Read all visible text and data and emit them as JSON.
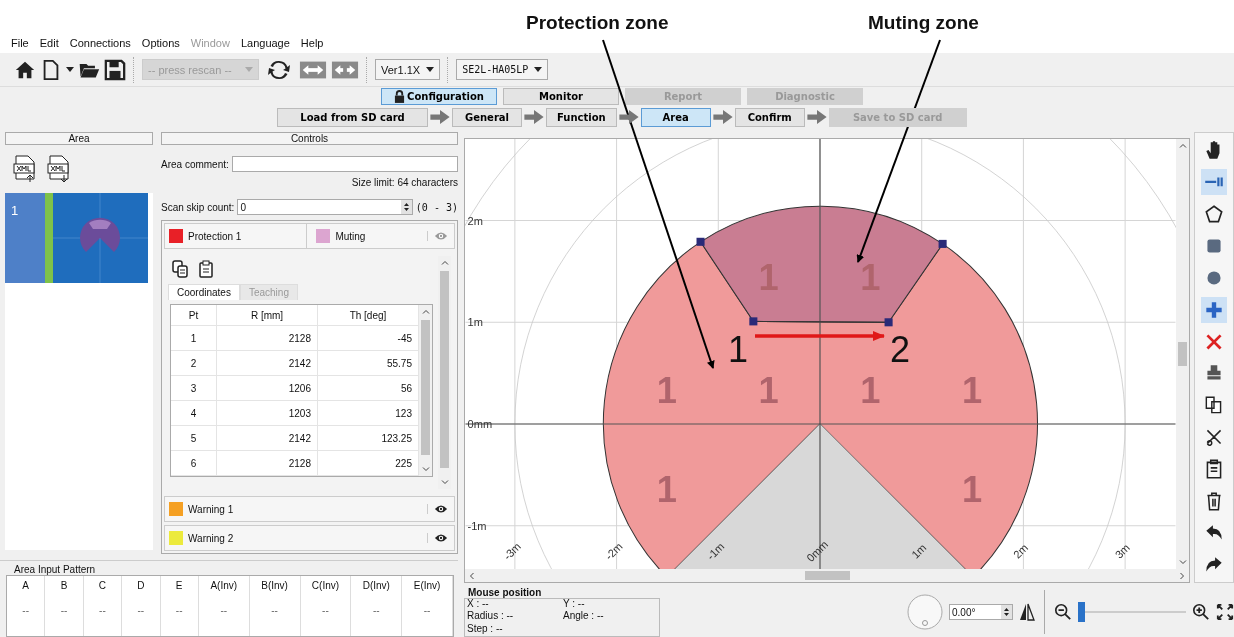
{
  "annotations": {
    "labels": [
      "Protection zone",
      "Muting zone"
    ],
    "point_labels": [
      "1",
      "2"
    ]
  },
  "menu": [
    {
      "label": "File",
      "disabled": false
    },
    {
      "label": "Edit",
      "disabled": false
    },
    {
      "label": "Connections",
      "disabled": false
    },
    {
      "label": "Options",
      "disabled": false
    },
    {
      "label": "Window",
      "disabled": true
    },
    {
      "label": "Language",
      "disabled": false
    },
    {
      "label": "Help",
      "disabled": false
    }
  ],
  "toolbar": {
    "port_placeholder": "-- press rescan --",
    "version": "Ver1.1X",
    "model": "SE2L-HA05LP"
  },
  "mode_tabs": [
    {
      "label": "Configuration",
      "selected": true,
      "disabled": false
    },
    {
      "label": "Monitor",
      "selected": false,
      "disabled": false
    },
    {
      "label": "Report",
      "selected": false,
      "disabled": true
    },
    {
      "label": "Diagnostic",
      "selected": false,
      "disabled": true
    }
  ],
  "steps": [
    {
      "label": "Load from SD card",
      "selected": false,
      "disabled": false
    },
    {
      "label": "General",
      "selected": false,
      "disabled": false
    },
    {
      "label": "Function",
      "selected": false,
      "disabled": false
    },
    {
      "label": "Area",
      "selected": true,
      "disabled": false
    },
    {
      "label": "Confirm",
      "selected": false,
      "disabled": false
    },
    {
      "label": "Save to SD card",
      "selected": false,
      "disabled": true
    }
  ],
  "area_panel": {
    "title": "Area",
    "items": [
      {
        "label": "1",
        "selected": true
      }
    ]
  },
  "controls": {
    "title": "Controls",
    "comment_label": "Area comment:",
    "size_limit": "Size limit: 64 characters",
    "skip_label": "Scan skip count:",
    "skip_value": "0",
    "skip_range": "(0 - 3)",
    "zones": [
      {
        "name": "Protection 1",
        "color": "#e82027",
        "expanded": true,
        "muting": {
          "name": "Muting",
          "color": "#dca5d0"
        }
      },
      {
        "name": "Warning 1",
        "color": "#f5a023",
        "expanded": false
      },
      {
        "name": "Warning 2",
        "color": "#ecea3c",
        "expanded": false
      }
    ],
    "tabs": [
      {
        "label": "Coordinates",
        "selected": true
      },
      {
        "label": "Teaching",
        "selected": false
      }
    ],
    "table": {
      "columns": [
        "Pt",
        "R [mm]",
        "Th [deg]"
      ],
      "rows": [
        [
          "1",
          "2128",
          "-45"
        ],
        [
          "2",
          "2142",
          "55.75"
        ],
        [
          "3",
          "1206",
          "56"
        ],
        [
          "4",
          "1203",
          "123"
        ],
        [
          "5",
          "2142",
          "123.25"
        ],
        [
          "6",
          "2128",
          "225"
        ]
      ]
    }
  },
  "canvas": {
    "y_labels": [
      "2m",
      "1m",
      "0mm",
      "-1m"
    ],
    "x_labels": [
      "-3m",
      "-2m",
      "-1m",
      "0mm",
      "1m",
      "2m",
      "3m"
    ],
    "zone_marks": [
      "1",
      "1",
      "1",
      "1",
      "1",
      "1",
      "1",
      "1"
    ]
  },
  "input_pattern": {
    "title": "Area Input Pattern",
    "columns": [
      "A",
      "B",
      "C",
      "D",
      "E",
      "A(Inv)",
      "B(Inv)",
      "C(Inv)",
      "D(Inv)",
      "E(Inv)"
    ],
    "values": [
      "--",
      "--",
      "--",
      "--",
      "--",
      "--",
      "--",
      "--",
      "--",
      "--"
    ]
  },
  "mouse_position": {
    "title": "Mouse position",
    "fields": [
      "X : --",
      "Y : --",
      "Radius : --",
      "Angle : --",
      "Step : --"
    ]
  },
  "rotation": {
    "value": "0.00°"
  },
  "zoom": {
    "level": 0.0
  }
}
